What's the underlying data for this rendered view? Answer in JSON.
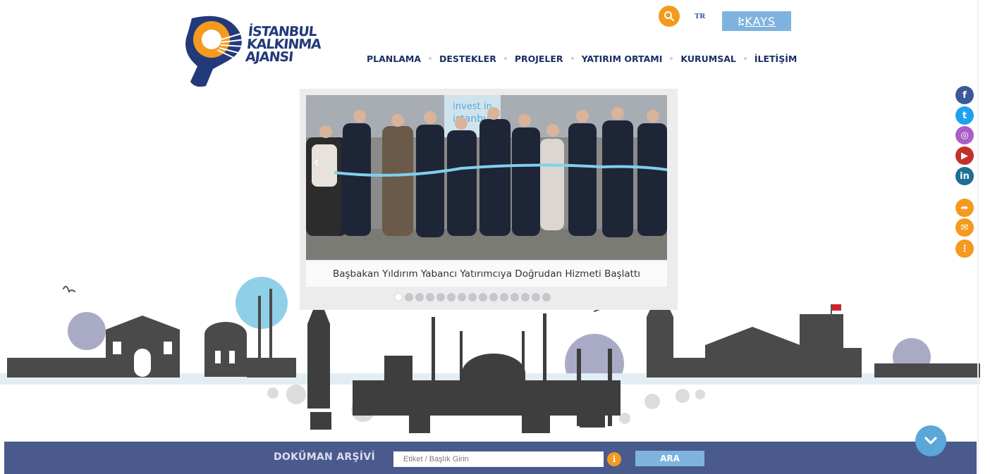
{
  "logo": {
    "lines": [
      "İSTANBUL",
      "KALKINMA",
      "AJANSI"
    ]
  },
  "header": {
    "search_icon": "search-icon",
    "language": "TR",
    "kays_label": "KAYS"
  },
  "nav": {
    "items": [
      "PLANLAMA",
      "DESTEKLER",
      "PROJELER",
      "YATIRIM ORTAMI",
      "KURUMSAL",
      "İLETİŞİM"
    ]
  },
  "slider": {
    "photo_sign": "invest in istanbul",
    "caption": "Başbakan Yıldırım Yabancı Yatırımcıya Doğrudan Hizmeti Başlattı",
    "total_slides": 15,
    "active_index": 0
  },
  "social": {
    "items": [
      {
        "icon": "facebook-icon",
        "glyph": "f",
        "color": "#3b5998"
      },
      {
        "icon": "twitter-icon",
        "glyph": "t",
        "color": "#1da1f2"
      },
      {
        "icon": "instagram-icon",
        "glyph": "◎",
        "color": "#a95fc6"
      },
      {
        "icon": "youtube-icon",
        "glyph": "▶",
        "color": "#c4302b"
      },
      {
        "icon": "linkedin-icon",
        "glyph": "in",
        "color": "#1e6f93"
      },
      {
        "icon": "share-icon",
        "glyph": "➦",
        "color": "#f39a1f"
      },
      {
        "icon": "mail-icon",
        "glyph": "✉",
        "color": "#f39a1f"
      },
      {
        "icon": "sitemap-icon",
        "glyph": "⋮",
        "color": "#f39a1f"
      }
    ]
  },
  "archive": {
    "label": "DOKÜMAN ARŞİVİ",
    "placeholder": "Etiket / Başlık Girin",
    "info_glyph": "i",
    "search_button": "ARA"
  },
  "colors": {
    "navy": "#1b2f66",
    "orange": "#f39a1f",
    "light_blue": "#7fb3df",
    "bar": "#4a5a8d"
  }
}
